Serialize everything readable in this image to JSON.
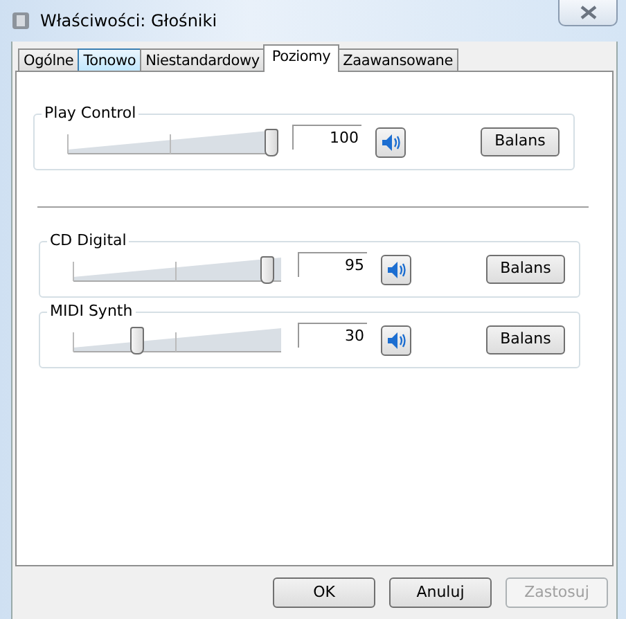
{
  "window": {
    "title": "Właściwości: Głośniki"
  },
  "tabs": [
    {
      "label": "Ogólne",
      "selected": false
    },
    {
      "label": "Tonowo",
      "selected": false
    },
    {
      "label": "Niestandardowy",
      "selected": false
    },
    {
      "label": "Poziomy",
      "selected": true
    },
    {
      "label": "Zaawansowane",
      "selected": false
    }
  ],
  "master": {
    "name": "Play Control",
    "level": 1,
    "value": "100",
    "muted": false,
    "balance_button": "Balans"
  },
  "channels": [
    {
      "name": "CD Digital",
      "level": 0.95,
      "value": "95",
      "muted": false,
      "balance_button": "Balans"
    },
    {
      "name": "MIDI Synth",
      "level": 0.3,
      "value": "30",
      "muted": false,
      "balance_button": "Balans"
    }
  ],
  "buttons": [
    {
      "label": "OK",
      "disabled": false
    },
    {
      "label": "Anuluj",
      "disabled": false
    },
    {
      "label": "Zastosuj",
      "disabled": true
    }
  ]
}
